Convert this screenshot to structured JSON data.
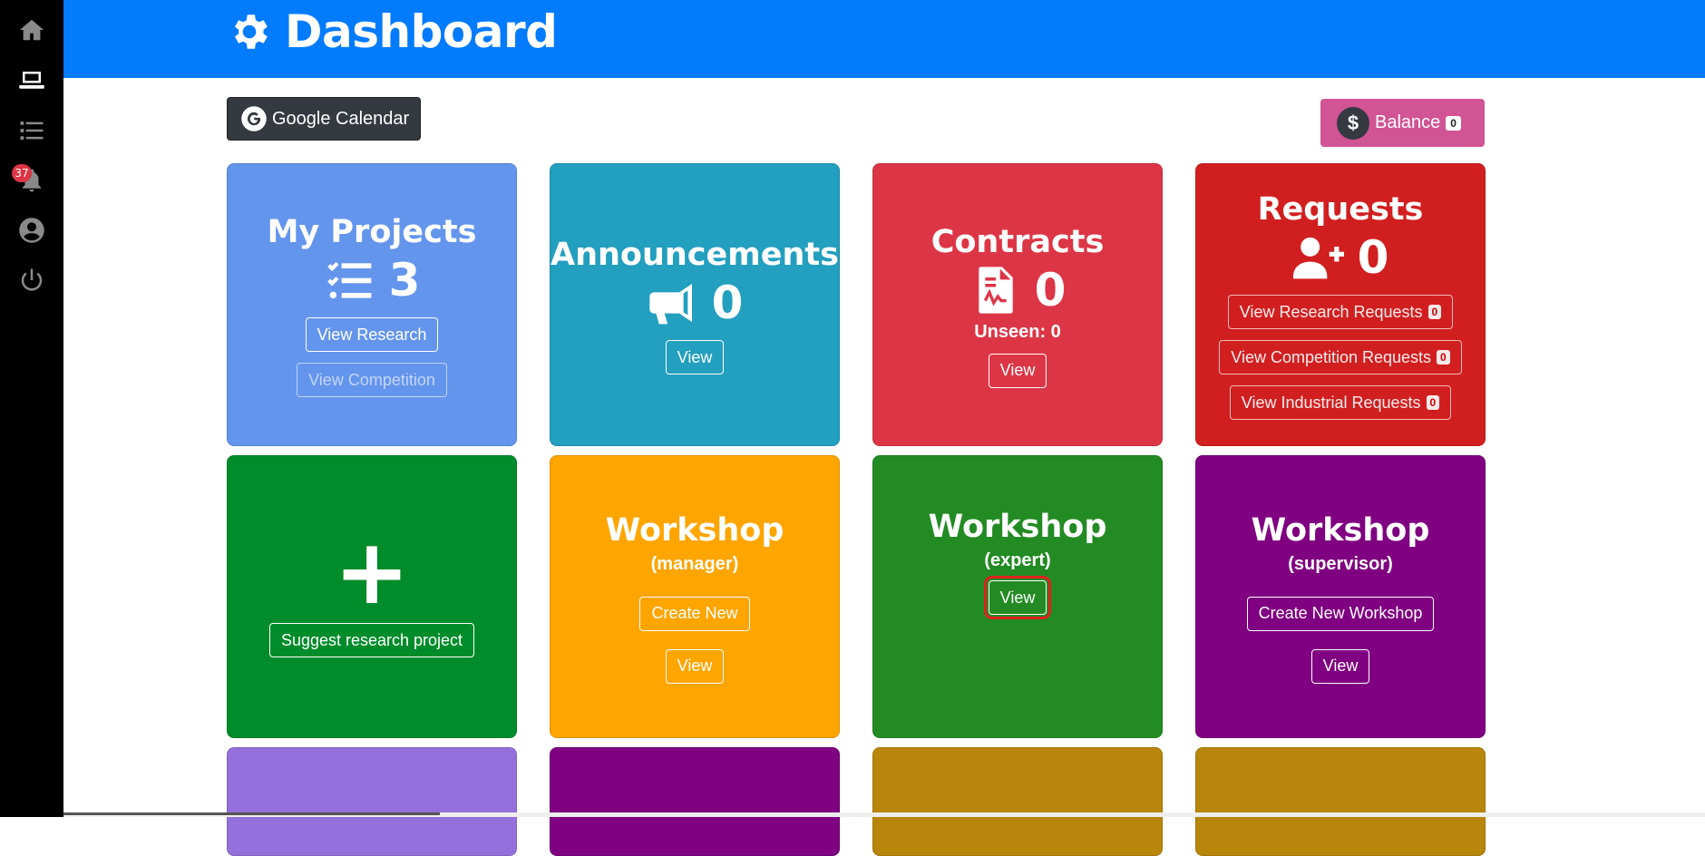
{
  "header": {
    "title": "Dashboard"
  },
  "sidebar": {
    "notification_count": "37"
  },
  "google_calendar": {
    "label": "Google Calendar"
  },
  "balance": {
    "symbol": "$",
    "label": "Balance",
    "count": "0"
  },
  "cards": {
    "my_projects": {
      "title": "My Projects",
      "count": "3",
      "view_research": "View Research",
      "view_competition": "View Competition"
    },
    "announcements": {
      "title": "Announcements",
      "count": "0",
      "view": "View"
    },
    "contracts": {
      "title": "Contracts",
      "count": "0",
      "unseen": "Unseen: 0",
      "view": "View"
    },
    "requests": {
      "title": "Requests",
      "count": "0",
      "view_research": "View Research Requests",
      "view_research_count": "0",
      "view_competition": "View Competition Requests",
      "view_competition_count": "0",
      "view_industrial": "View Industrial Requests",
      "view_industrial_count": "0"
    },
    "suggest": {
      "plus": "+",
      "label": "Suggest research project"
    },
    "workshop_manager": {
      "title": "Workshop",
      "sub": "(manager)",
      "create": "Create New",
      "view": "View"
    },
    "workshop_expert": {
      "title": "Workshop",
      "sub": "(expert)",
      "view": "View"
    },
    "workshop_supervisor": {
      "title": "Workshop",
      "sub": "(supervisor)",
      "create": "Create New Workshop",
      "view": "View"
    }
  },
  "colors": {
    "header": "#037bfd",
    "my_projects": "#6495ed",
    "announcements": "#239fbf",
    "contracts": "#dc3646",
    "requests": "#d11f20",
    "suggest": "#008c2a",
    "workshop_manager": "#fea500",
    "workshop_expert": "#238b23",
    "workshop_supervisor": "#7f0080",
    "row3_1": "#9370db",
    "row3_2": "#7f0080",
    "row3_3": "#b7860b",
    "row3_4": "#b7860b"
  }
}
